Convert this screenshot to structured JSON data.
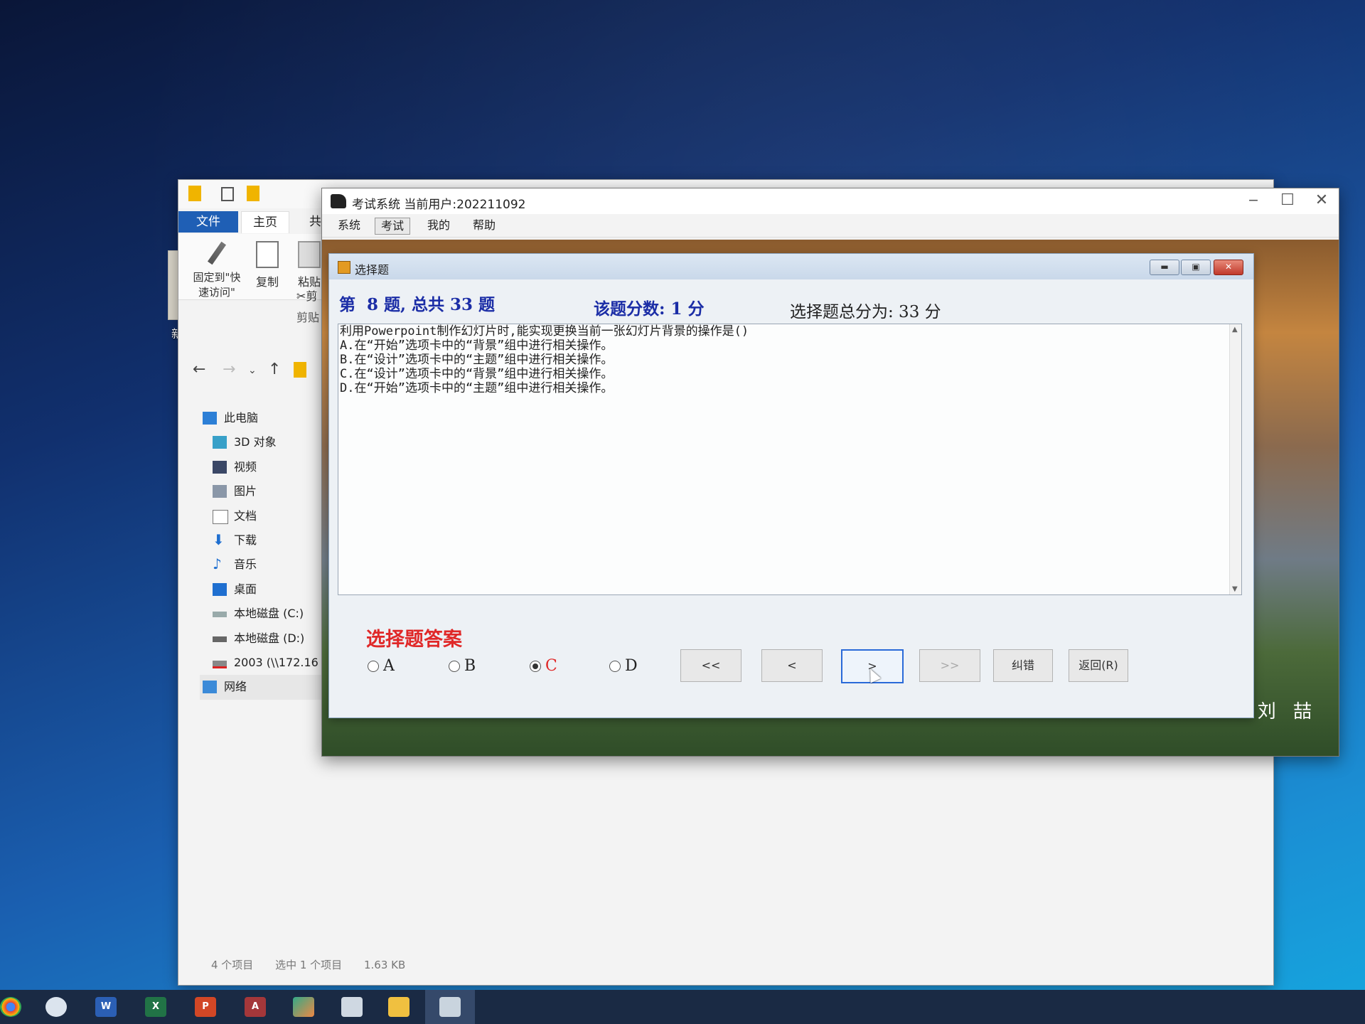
{
  "desktop": {
    "icon_label": "新建"
  },
  "explorer": {
    "tabs": [
      "文件",
      "主页",
      "共"
    ],
    "ribbon": {
      "pin_label": "固定到\"快速访问\"",
      "copy_label": "复制",
      "paste_label": "粘贴",
      "cut_label": "剪",
      "group_label": "剪贴"
    },
    "nav_items": [
      {
        "label": "此电脑",
        "icon": "computer-icon"
      },
      {
        "label": "3D 对象",
        "icon": "cube-icon"
      },
      {
        "label": "视频",
        "icon": "video-icon"
      },
      {
        "label": "图片",
        "icon": "picture-icon"
      },
      {
        "label": "文档",
        "icon": "document-icon"
      },
      {
        "label": "下载",
        "icon": "download-icon"
      },
      {
        "label": "音乐",
        "icon": "music-icon"
      },
      {
        "label": "桌面",
        "icon": "desktop-icon"
      },
      {
        "label": "本地磁盘 (C:)",
        "icon": "drive-icon"
      },
      {
        "label": "本地磁盘 (D:)",
        "icon": "drive-icon"
      },
      {
        "label": "2003 (\\\\172.16",
        "icon": "network-drive-icon"
      },
      {
        "label": "网络",
        "icon": "network-icon"
      }
    ],
    "status": {
      "count": "4 个项目",
      "selected": "选中 1 个项目",
      "size": "1.63 KB"
    }
  },
  "exam_window": {
    "title": "考试系统 当前用户:202211092",
    "menu": [
      "系统",
      "考试",
      "我的",
      "帮助"
    ],
    "active_menu": "考试",
    "bg_text": "刘 喆"
  },
  "dialog": {
    "title": "选择题",
    "question_progress": "第  8 题, 总共 33 题",
    "question_score": "该题分数: 1 分",
    "total_score": "选择题总分为: 33 分",
    "question_lines": [
      "利用Powerpoint制作幻灯片时,能实现更换当前一张幻灯片背景的操作是()",
      "A.在“开始”选项卡中的“背景”组中进行相关操作。",
      "B.在“设计”选项卡中的“主题”组中进行相关操作。",
      "C.在“设计”选项卡中的“背景”组中进行相关操作。",
      "D.在“开始”选项卡中的“主题”组中进行相关操作。"
    ],
    "answer_title": "选择题答案",
    "options": [
      "A",
      "B",
      "C",
      "D"
    ],
    "selected_option": "C",
    "buttons": {
      "first": "<<",
      "prev": "<",
      "next": ">",
      "last": ">>",
      "correct": "纠错",
      "back": "返回(R)"
    }
  },
  "taskbar": {
    "icons": [
      "chrome-icon",
      "browser-icon",
      "word-icon",
      "excel-icon",
      "powerpoint-icon",
      "access-icon",
      "image-app-icon",
      "notepad-icon",
      "file-explorer-icon",
      "exam-system-icon"
    ]
  },
  "colors": {
    "question_blue": "#1b2da6",
    "answer_red": "#e02828",
    "ribbon_file_blue": "#1f5fb5"
  }
}
